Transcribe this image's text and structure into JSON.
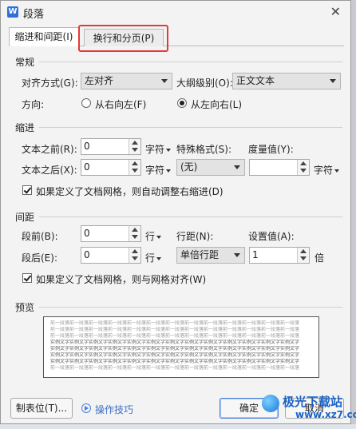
{
  "window": {
    "title": "段落",
    "app_icon_letter": "W",
    "close_glyph": "✕"
  },
  "tabs": [
    {
      "label": "缩进和间距(I)",
      "active": true
    },
    {
      "label": "换行和分页(P)",
      "active": false
    }
  ],
  "general": {
    "section": "常规",
    "alignment_label": "对齐方式(G):",
    "alignment_value": "左对齐",
    "outline_label": "大纲级别(O):",
    "outline_value": "正文文本",
    "direction_label": "方向:",
    "rtl_label": "从右向左(F)",
    "ltr_label": "从左向右(L)"
  },
  "indent": {
    "section": "缩进",
    "before_label": "文本之前(R):",
    "before_value": "0",
    "before_unit": "字符",
    "after_label": "文本之后(X):",
    "after_value": "0",
    "after_unit": "字符",
    "special_label": "特殊格式(S):",
    "special_value": "(无)",
    "measure_label": "度量值(Y):",
    "measure_value": "",
    "measure_unit": "字符",
    "grid_check_label": "如果定义了文档网格，则自动调整右缩进(D)"
  },
  "spacing": {
    "section": "间距",
    "before_label": "段前(B):",
    "before_value": "0",
    "before_unit": "行",
    "after_label": "段后(E):",
    "after_value": "0",
    "after_unit": "行",
    "line_label": "行距(N):",
    "line_value": "单倍行距",
    "setting_label": "设置值(A):",
    "setting_value": "1",
    "setting_unit": "倍",
    "grid_check_label": "如果定义了文档网格，则与网格对齐(W)"
  },
  "preview": {
    "section": "预览",
    "line_prev": "前一段落前一段落前一段落前一段落前一段落前一段落前一段落前一段落前一段落前一段落前一段落前一段落前一段落",
    "line_sample": "实例文字实例文字实例文字实例文字实例文字实例文字实例文字实例文字实例文字实例文字实例文字实例文字实例文字"
  },
  "footer": {
    "tabstops_button": "制表位(T)...",
    "tips_link": "操作技巧",
    "ok_button": "确定",
    "cancel_button": "取消"
  },
  "watermark": {
    "name": "极光下载站",
    "url": "www.xz7.com"
  },
  "colors": {
    "highlight": "#e53935",
    "link": "#3a6fc7",
    "brand": "#1a63c7"
  }
}
